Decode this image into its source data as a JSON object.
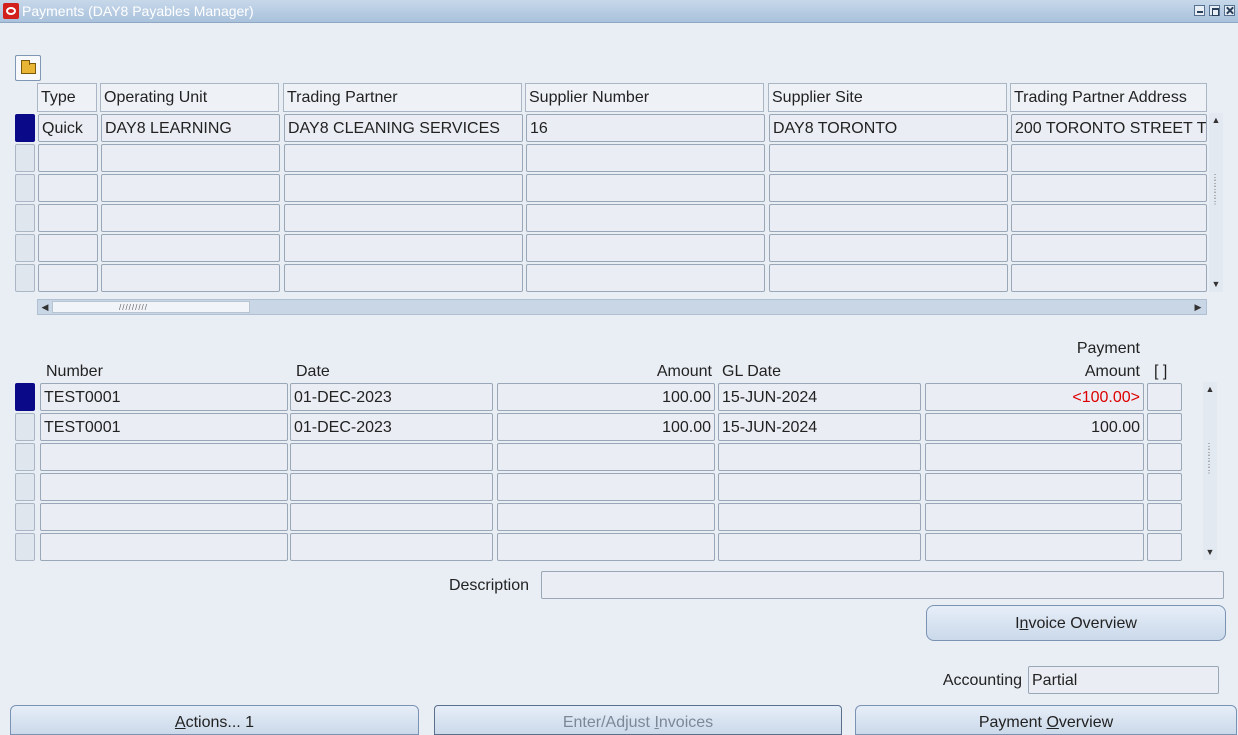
{
  "window": {
    "title": "Payments (DAY8 Payables Manager)"
  },
  "top_table": {
    "columns": [
      "Type",
      "Operating Unit",
      "Trading Partner",
      "Supplier Number",
      "Supplier Site",
      "Trading Partner Address"
    ],
    "rows": [
      [
        "Quick",
        "DAY8 LEARNING",
        "DAY8 CLEANING SERVICES",
        "16",
        "DAY8 TORONTO",
        "200 TORONTO STREET  T"
      ],
      [
        "",
        "",
        "",
        "",
        "",
        ""
      ],
      [
        "",
        "",
        "",
        "",
        "",
        ""
      ],
      [
        "",
        "",
        "",
        "",
        "",
        ""
      ],
      [
        "",
        "",
        "",
        "",
        "",
        ""
      ],
      [
        "",
        "",
        "",
        "",
        "",
        ""
      ]
    ]
  },
  "invoice_table": {
    "columns": {
      "number": "Number",
      "date": "Date",
      "amount": "Amount",
      "gl_date": "GL Date",
      "payment_line1": "Payment",
      "payment_line2": "Amount",
      "flex": "[ ]"
    },
    "rows": [
      {
        "number": "TEST0001",
        "date": "01-DEC-2023",
        "amount": "100.00",
        "gl_date": "15-JUN-2024",
        "payment_amount": "<100.00>",
        "payment_negative": true
      },
      {
        "number": "TEST0001",
        "date": "01-DEC-2023",
        "amount": "100.00",
        "gl_date": "15-JUN-2024",
        "payment_amount": "100.00",
        "payment_negative": false
      },
      {
        "number": "",
        "date": "",
        "amount": "",
        "gl_date": "",
        "payment_amount": ""
      },
      {
        "number": "",
        "date": "",
        "amount": "",
        "gl_date": "",
        "payment_amount": ""
      },
      {
        "number": "",
        "date": "",
        "amount": "",
        "gl_date": "",
        "payment_amount": ""
      },
      {
        "number": "",
        "date": "",
        "amount": "",
        "gl_date": "",
        "payment_amount": ""
      }
    ]
  },
  "description": {
    "label": "Description",
    "value": ""
  },
  "invoice_overview_button": {
    "pre": "I",
    "mnemonic": "n",
    "post": "voice Overview"
  },
  "accounting": {
    "label": "Accounting",
    "value": "Partial"
  },
  "bottom_buttons": {
    "actions": {
      "mnemonic": "A",
      "post": "ctions... 1"
    },
    "enter_adjust": {
      "pre": "Enter/Adjust ",
      "mnemonic": "I",
      "post": "nvoices"
    },
    "payment_overview": {
      "pre": "Payment ",
      "mnemonic": "O",
      "post": "verview"
    }
  },
  "colors": {
    "title_bar": "#a9c2dc",
    "selected_row_indicator": "#0a0a88",
    "negative_amount": "#dd0000"
  },
  "icons": [
    "oracle-logo-icon",
    "folder-open-icon",
    "minimize-icon",
    "maximize-icon",
    "close-icon"
  ]
}
